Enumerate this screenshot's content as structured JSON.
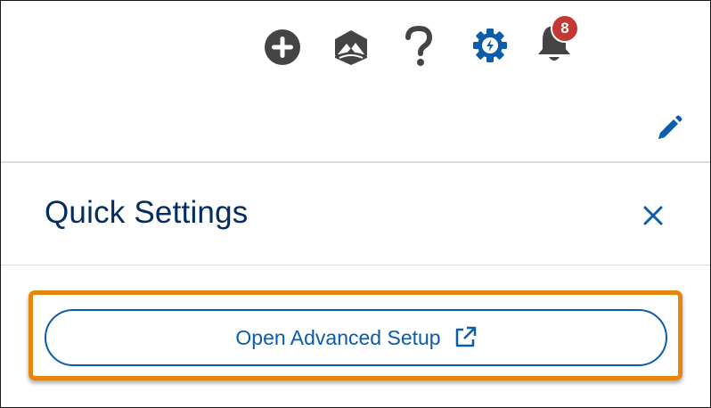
{
  "header": {
    "notification_count": "8",
    "icons": [
      "add-icon",
      "trailhead-icon",
      "help-icon",
      "setup-gear-icon",
      "notifications-bell-icon",
      "edit-pencil-icon"
    ]
  },
  "panel": {
    "title": "Quick Settings",
    "setup_button_label": "Open Advanced Setup",
    "highlight_color": "#e5870e"
  },
  "colors": {
    "brand_blue": "#0b5cab",
    "title_navy": "#032d60",
    "icon_gray": "#444444",
    "badge_red": "#c23934"
  }
}
